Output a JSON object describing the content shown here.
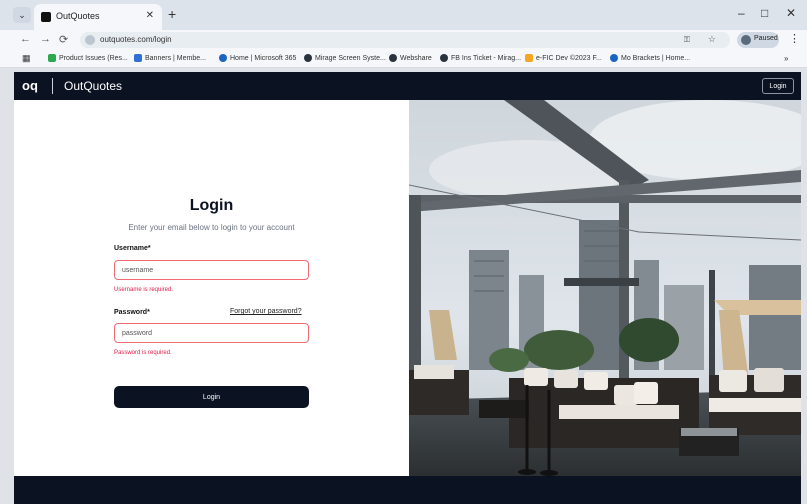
{
  "browser": {
    "tab": {
      "title": "OutQuotes"
    },
    "new_tab": "+",
    "controls": {
      "minimize": "–",
      "maximize": "□",
      "close": "✕"
    },
    "address": "outquotes.com/login",
    "address_icons": [
      "key-icon",
      "star-icon"
    ],
    "profile_name": "Paused",
    "bookmarks": [
      {
        "label": "Product Issues (Res...",
        "color": "#2ca84f"
      },
      {
        "label": "Banners | Membe...",
        "color": "#2f6fd6"
      },
      {
        "label": "Home | Microsoft 365",
        "color": "#1a65c4"
      },
      {
        "label": "Mirage Screen Syste...",
        "color": "#2b3340"
      },
      {
        "label": "Webshare",
        "color": "#2b3340"
      },
      {
        "label": "FB Ins Ticket - Mirag...",
        "color": "#2b3340"
      },
      {
        "label": "e-FIC Dev ©2023 F...",
        "color": "#f5a623"
      },
      {
        "label": "Mo Brackets | Home...",
        "color": "#1a65c4"
      }
    ]
  },
  "app": {
    "logo": "oq",
    "brand": "OutQuotes",
    "login_top": "Login"
  },
  "form": {
    "title": "Login",
    "subtitle": "Enter your email below to login to your account",
    "username_label": "Username*",
    "username_placeholder": "username",
    "username_error": "Username is required.",
    "password_label": "Password*",
    "forgot": "Forgot your password?",
    "password_placeholder": "password",
    "password_error": "Password is required.",
    "submit": "Login"
  },
  "colors": {
    "primary": "#0b1221",
    "error": "#e11d48",
    "error_border": "#f06b74"
  }
}
